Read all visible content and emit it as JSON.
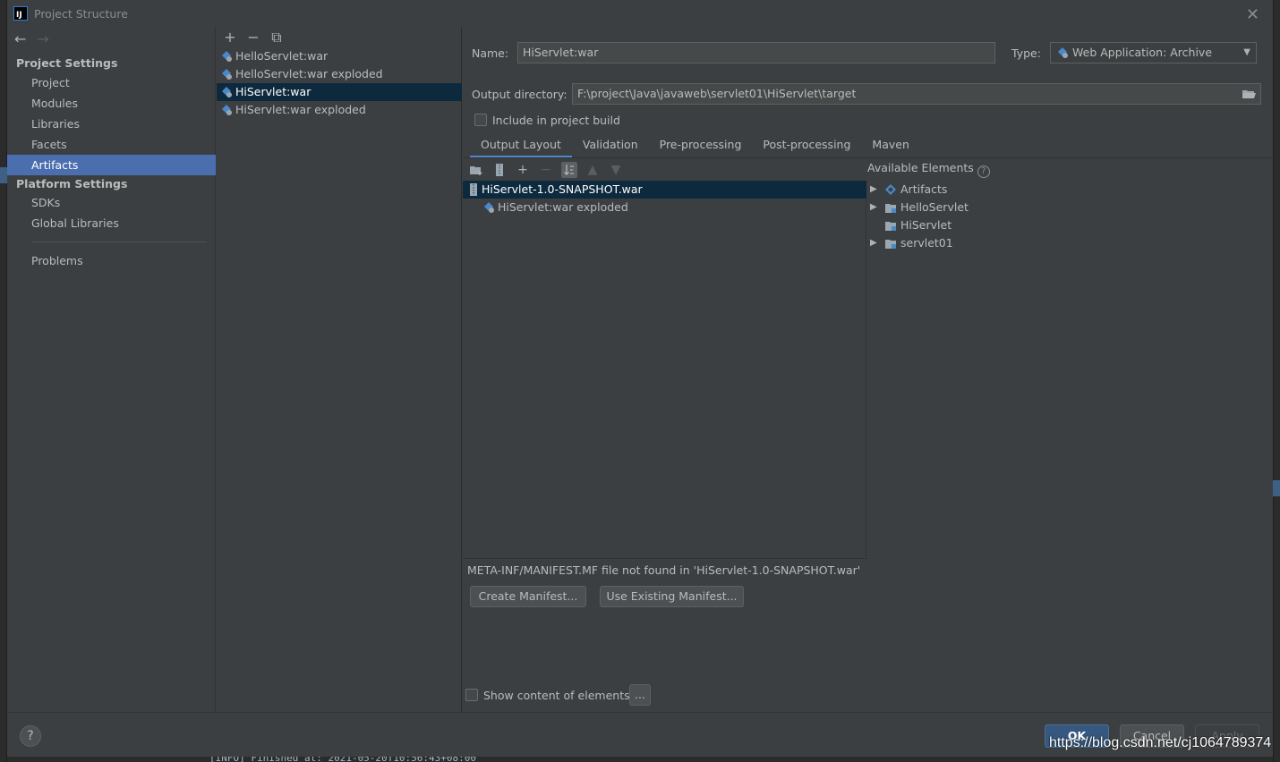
{
  "window": {
    "title": "Project Structure",
    "app_icon_text": "IJ"
  },
  "sidebar": {
    "project_settings_title": "Project Settings",
    "project_items": [
      "Project",
      "Modules",
      "Libraries",
      "Facets",
      "Artifacts"
    ],
    "platform_settings_title": "Platform Settings",
    "platform_items": [
      "SDKs",
      "Global Libraries"
    ],
    "problems": "Problems",
    "selected": "Artifacts"
  },
  "artifacts": {
    "items": [
      "HelloServlet:war",
      "HelloServlet:war exploded",
      "HiServlet:war",
      "HiServlet:war exploded"
    ],
    "selected": "HiServlet:war"
  },
  "editor": {
    "name_label": "Name:",
    "name_value": "HiServlet:war",
    "type_label": "Type:",
    "type_value": "Web Application: Archive",
    "output_label": "Output directory:",
    "output_value": "F:\\project\\Java\\javaweb\\servlet01\\HiServlet\\target",
    "include_label": "Include in project build",
    "include_checked": false,
    "tabs": [
      "Output Layout",
      "Validation",
      "Pre-processing",
      "Post-processing",
      "Maven"
    ],
    "active_tab": "Output Layout"
  },
  "output_layout": {
    "root": "HiServlet-1.0-SNAPSHOT.war",
    "children": [
      "HiServlet:war exploded"
    ]
  },
  "available": {
    "title": "Available Elements",
    "help": "?",
    "items": [
      "Artifacts",
      "HelloServlet",
      "HiServlet",
      "servlet01"
    ]
  },
  "manifest": {
    "message": "META-INF/MANIFEST.MF file not found in 'HiServlet-1.0-SNAPSHOT.war'",
    "create_label": "Create Manifest...",
    "existing_label": "Use Existing Manifest..."
  },
  "show_content": {
    "label": "Show content of elements",
    "button": "..."
  },
  "footer": {
    "help": "?",
    "ok": "OK",
    "cancel": "Cancel",
    "apply": "Apply"
  },
  "console_text": "[INFO] Finished at: 2021-05-20T10:56:43+08:00",
  "watermark": "https://blog.csdn.net/cj1064789374",
  "colors": {
    "accent": "#4b6eaf",
    "selection": "#0d293e",
    "background": "#3c3f41",
    "ok_button": "#365880"
  }
}
